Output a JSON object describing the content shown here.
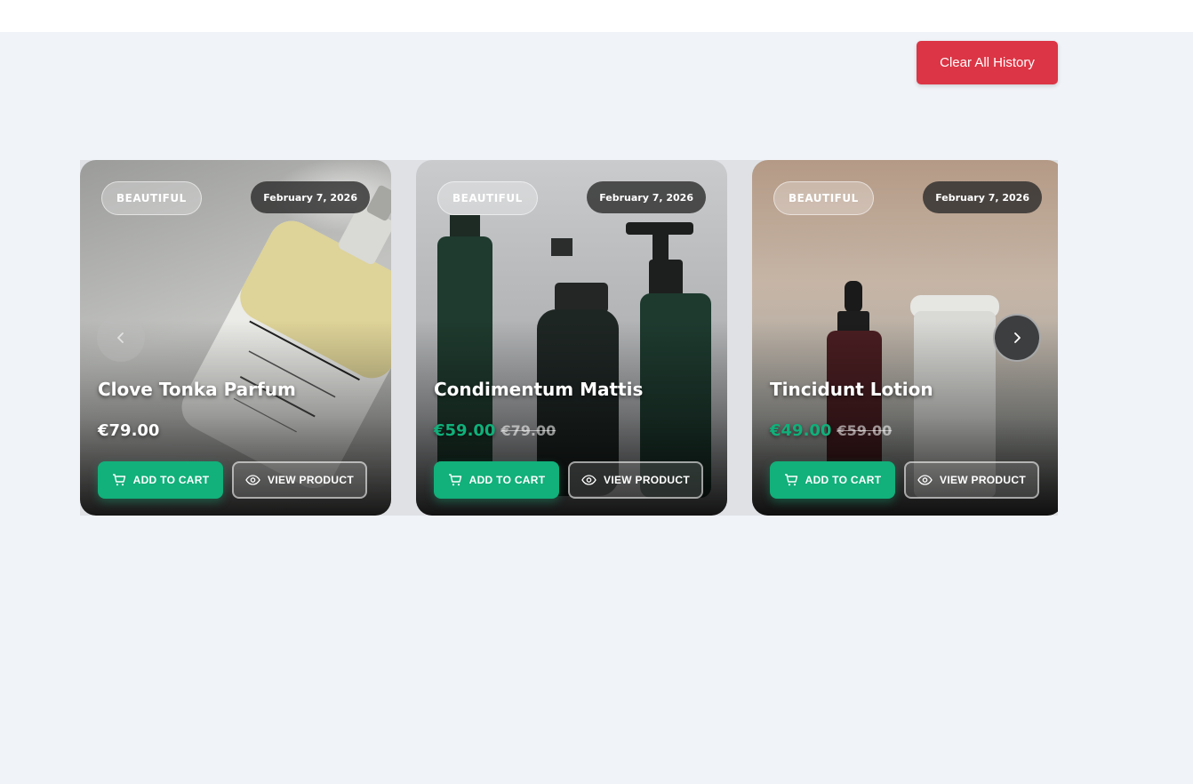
{
  "toolbar": {
    "clear_label": "Clear All History"
  },
  "colors": {
    "danger": "#dc3545",
    "accent": "#12b07a",
    "page_bg": "#f0f3f8"
  },
  "icons": {
    "cart": "cart-icon",
    "view": "eye-icon",
    "prev": "chevron-left-icon",
    "next": "chevron-right-icon"
  },
  "products": [
    {
      "tag": "BEAUTIFUL",
      "date": "February 7, 2026",
      "name": "Clove Tonka Parfum",
      "price": "€79.00",
      "old_price": "",
      "cart_label": "ADD TO CART",
      "view_label": "VIEW PRODUCT"
    },
    {
      "tag": "BEAUTIFUL",
      "date": "February 7, 2026",
      "name": "Condimentum Mattis",
      "price": "€59.00",
      "old_price": "€79.00",
      "cart_label": "ADD TO CART",
      "view_label": "VIEW PRODUCT"
    },
    {
      "tag": "BEAUTIFUL",
      "date": "February 7, 2026",
      "name": "Tincidunt Lotion",
      "price": "€49.00",
      "old_price": "€59.00",
      "cart_label": "ADD TO CART",
      "view_label": "VIEW PRODUCT"
    }
  ]
}
